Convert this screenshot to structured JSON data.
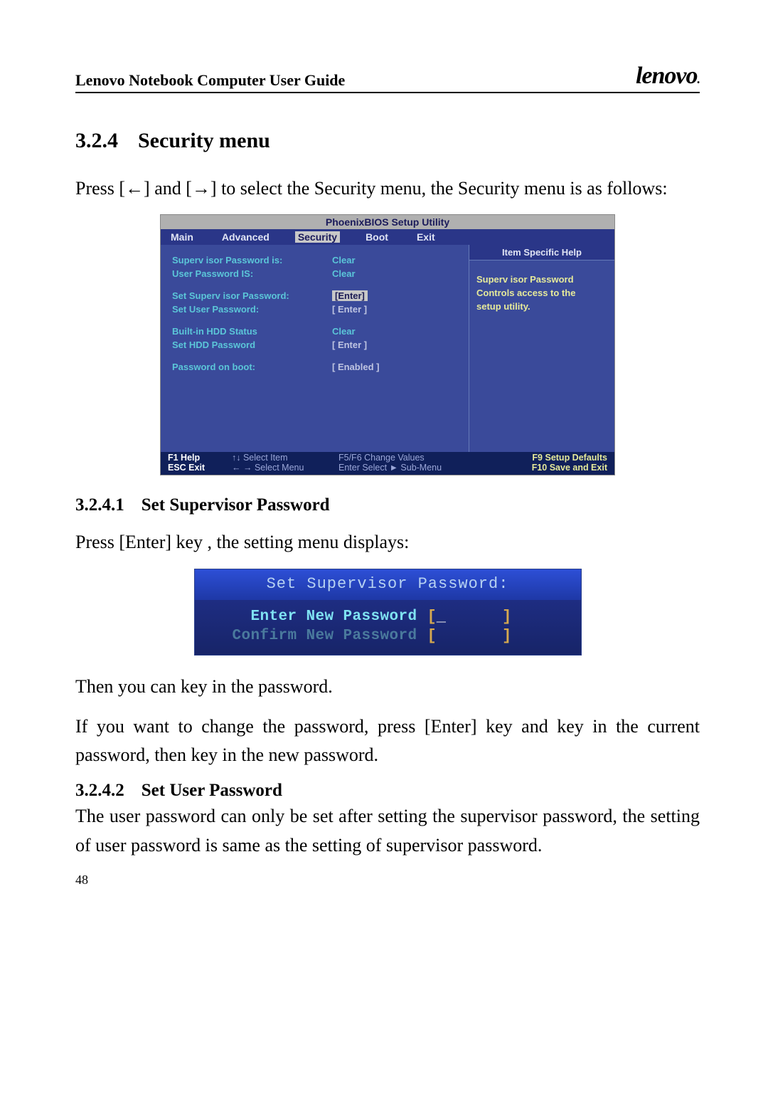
{
  "header": {
    "title": "Lenovo Notebook Computer User Guide",
    "brand": "lenovo"
  },
  "section": {
    "number": "3.2.4",
    "title": "Security menu",
    "intro": "Press [←] and [→] to select the Security menu, the Security menu is as follows:"
  },
  "bios": {
    "title": "PhoenixBIOS Setup Utility",
    "tabs": [
      "Main",
      "Advanced",
      "Security",
      "Boot",
      "Exit"
    ],
    "selectedTab": "Security",
    "rows": {
      "supv_status_label": "Superv isor  Password is:",
      "supv_status_val": "Clear",
      "user_status_label": "User Password IS:",
      "user_status_val": "Clear",
      "set_supv_label": "Set Superv isor  Password:",
      "set_supv_val": "[Enter]",
      "set_user_label": "Set User Password:",
      "set_user_val": "[ Enter ]",
      "hdd_status_label": "Built-in HDD Status",
      "hdd_status_val": "Clear",
      "set_hdd_label": "Set HDD Password",
      "set_hdd_val": "[ Enter ]",
      "pw_on_boot_label": "Password on boot:",
      "pw_on_boot_val": "[ Enabled ]"
    },
    "help": {
      "header": "Item Specific Help",
      "line1": "Superv isor  Password",
      "line2": "Controls access to the",
      "line3": "setup utility."
    },
    "footer": {
      "c1a": "F1  Help",
      "c1b": "ESC Exit",
      "c2a": "↑↓ Select Item",
      "c2b": "← → Select Menu",
      "c3a": "F5/F6 Change Values",
      "c3b": "Enter Select ► Sub-Menu",
      "c4a": "F9  Setup Defaults",
      "c4b": "F10 Save and Exit"
    }
  },
  "sub1": {
    "number": "3.2.4.1",
    "title": "Set Supervisor Password",
    "line": "Press [Enter] key , the setting menu displays:"
  },
  "pw": {
    "title": "Set Supervisor Password:",
    "enter_label": "Enter New Password",
    "confirm_label": "Confirm New Password"
  },
  "after_pw": {
    "p1": "Then you can key in the password.",
    "p2": "If you want to change the password, press [Enter] key and key in the current password, then key in the new password."
  },
  "sub2": {
    "number": "3.2.4.2",
    "title": "Set User Password",
    "body": "The user password can only be set after setting the supervisor password, the setting of user password is same as the setting of supervisor password."
  },
  "page_number": "48"
}
